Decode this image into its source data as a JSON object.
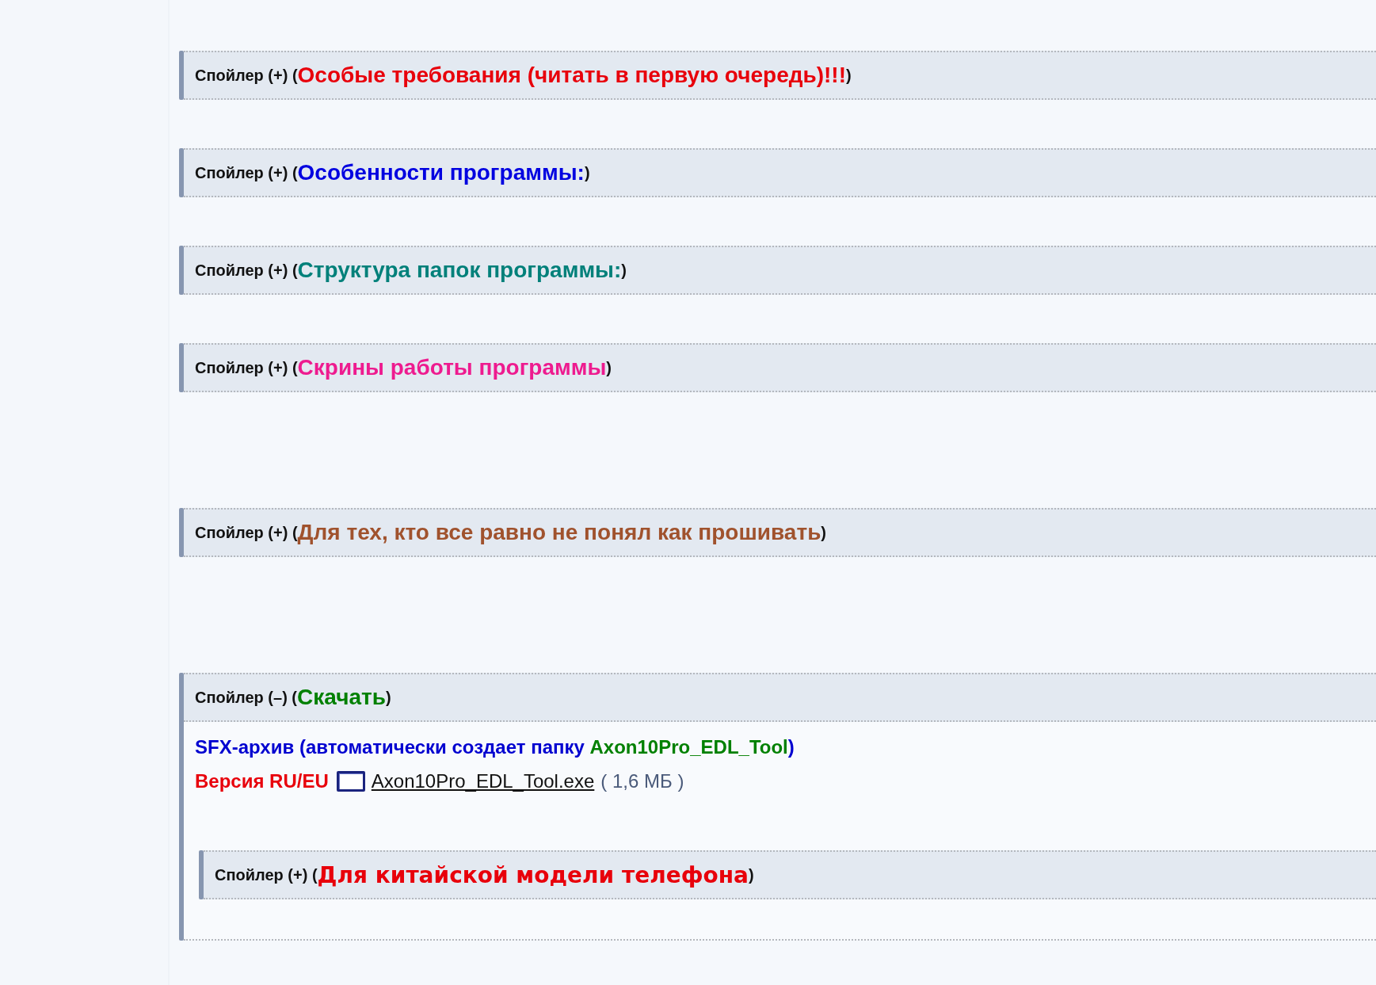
{
  "spoilers": [
    {
      "label": "Спойлер (+) (",
      "title": "Особые требования (читать в первую очередь)!!!",
      "close": ")",
      "color": "#e8000b"
    },
    {
      "label": "Спойлер (+) (",
      "title": "Особенности программы:",
      "close": ")",
      "color": "#0000e0"
    },
    {
      "label": "Спойлер (+) (",
      "title": "Структура папок программы:",
      "close": ")",
      "color": "#00807a"
    },
    {
      "label": "Спойлер (+) (",
      "title": "Скрины работы программы",
      "close": ")",
      "color": "#ee1b8f"
    },
    {
      "label": "Спойлер (+) (",
      "title": "Для тех, кто все равно не понял как прошивать",
      "close": ")",
      "color": "#a0522d"
    },
    {
      "label": "Спойлер (–) (",
      "title": "Скачать",
      "close": ")",
      "color": "#008000",
      "expanded": true,
      "body": {
        "archive_line": [
          {
            "text": "SFX-архив (автоматически создает папку ",
            "color": "#0000d0"
          },
          {
            "text": "Axon10Pro_EDL_Tool",
            "color": "#008000"
          },
          {
            "text": ")",
            "color": "#0000d0"
          }
        ],
        "version": {
          "label": "Версия RU/EU",
          "file_link": "Axon10Pro_EDL_Tool.exe",
          "size": "( 1,6 МБ )"
        },
        "nested_spoiler": {
          "label": "Спойлер (+) (",
          "title": "Для китайской модели телефона",
          "close": ")",
          "color": "#e8000b"
        }
      }
    }
  ]
}
